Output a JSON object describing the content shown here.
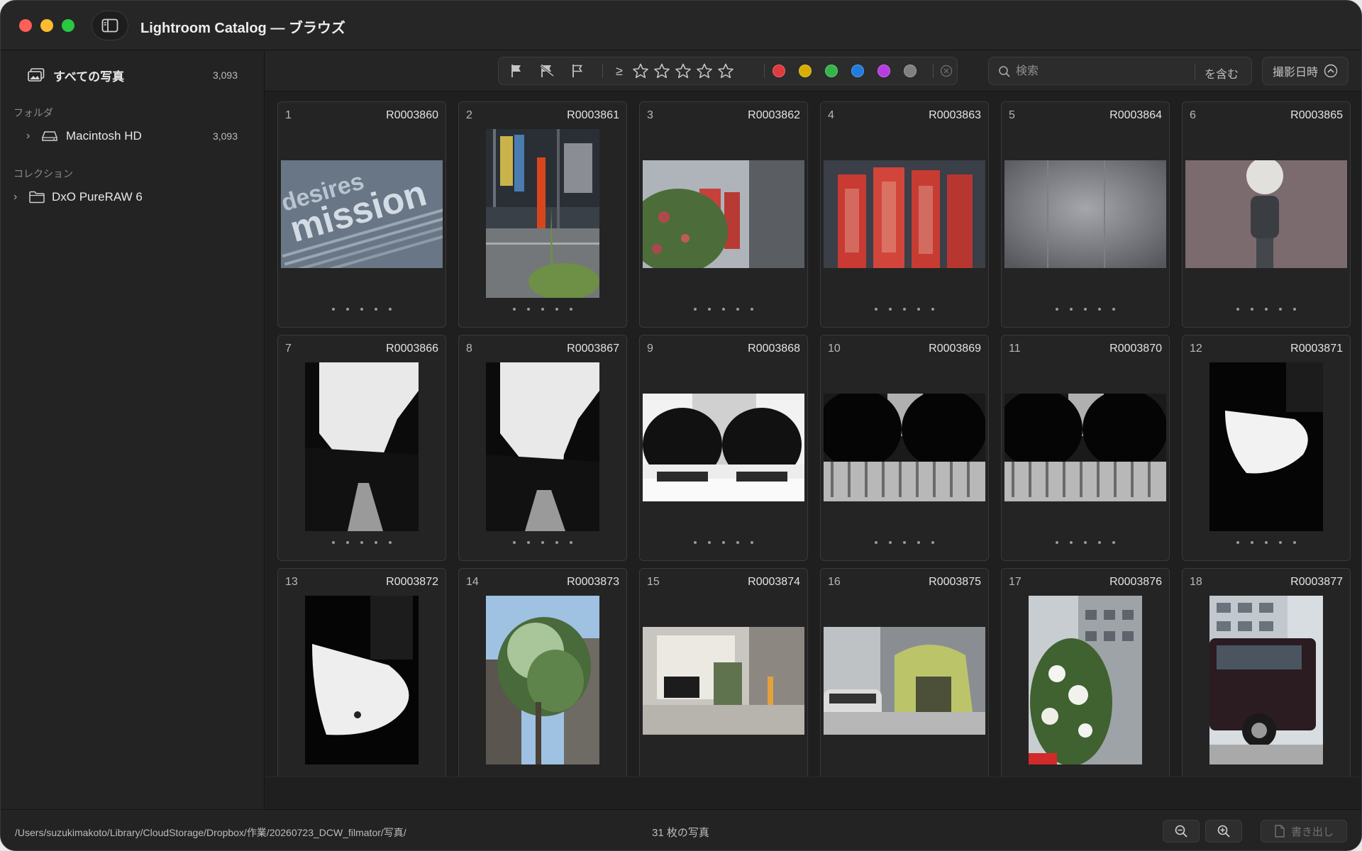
{
  "window": {
    "title": "Lightroom Catalog — ブラウズ"
  },
  "sidebar": {
    "all_photos": {
      "label": "すべての写真",
      "count": "3,093"
    },
    "folder_section": "フォルダ",
    "folder": {
      "label": "Macintosh HD",
      "count": "3,093"
    },
    "collection_section": "コレクション",
    "collection": {
      "label": "DxO PureRAW 6"
    }
  },
  "toolbar": {
    "rating_operator": "≥",
    "color_labels": [
      "#e0393e",
      "#d9ad00",
      "#33b54a",
      "#1e7ddf",
      "#b83ce0",
      "#808080"
    ],
    "search": {
      "placeholder": "検索",
      "mode": "を含む"
    },
    "sort": {
      "label": "撮影日時"
    }
  },
  "grid": {
    "photos": [
      {
        "index": "1",
        "name": "R0003860"
      },
      {
        "index": "2",
        "name": "R0003861"
      },
      {
        "index": "3",
        "name": "R0003862"
      },
      {
        "index": "4",
        "name": "R0003863"
      },
      {
        "index": "5",
        "name": "R0003864"
      },
      {
        "index": "6",
        "name": "R0003865"
      },
      {
        "index": "7",
        "name": "R0003866"
      },
      {
        "index": "8",
        "name": "R0003867"
      },
      {
        "index": "9",
        "name": "R0003868"
      },
      {
        "index": "10",
        "name": "R0003869"
      },
      {
        "index": "11",
        "name": "R0003870"
      },
      {
        "index": "12",
        "name": "R0003871"
      },
      {
        "index": "13",
        "name": "R0003872"
      },
      {
        "index": "14",
        "name": "R0003873"
      },
      {
        "index": "15",
        "name": "R0003874"
      },
      {
        "index": "16",
        "name": "R0003875"
      },
      {
        "index": "17",
        "name": "R0003876"
      },
      {
        "index": "18",
        "name": "R0003877"
      }
    ],
    "thumb_words": {
      "desires": "desires",
      "mission": "mission"
    }
  },
  "status": {
    "path": "/Users/suzukimakoto/Library/CloudStorage/Dropbox/作業/20260723_DCW_filmator/写真/",
    "count": "31 枚の写真",
    "export_label": "書き出し"
  }
}
